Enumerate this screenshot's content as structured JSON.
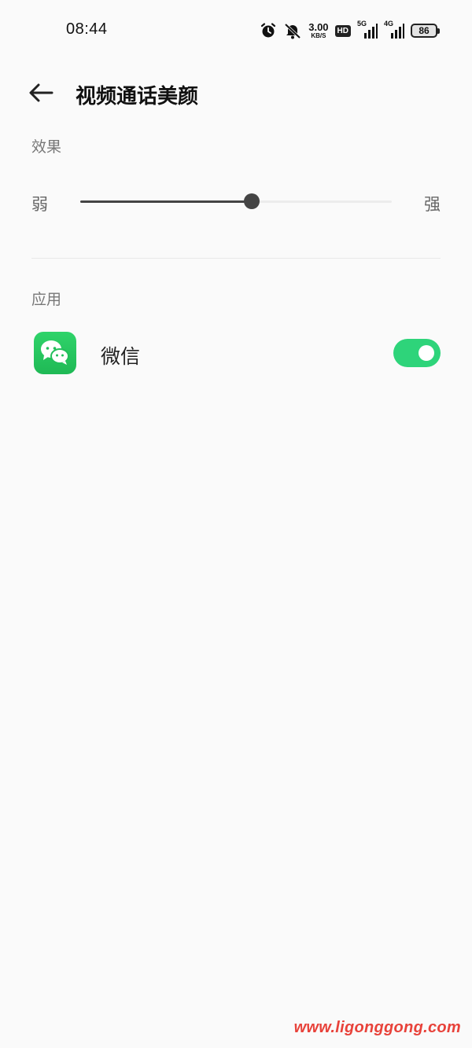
{
  "status_bar": {
    "time": "08:44",
    "net_speed_value": "3.00",
    "net_speed_unit": "KB/S",
    "hd_label": "HD",
    "signal_1_label": "5G",
    "signal_2_label": "4G",
    "battery_level": "86",
    "icons": [
      "alarm-icon",
      "mute-icon",
      "hd-voice-icon",
      "signal-5g-icon",
      "signal-4g-icon",
      "battery-icon"
    ]
  },
  "header": {
    "back_icon": "back-arrow-icon",
    "title": "视频通话美颜"
  },
  "effect_section": {
    "label": "效果",
    "slider": {
      "min_label": "弱",
      "max_label": "强",
      "value": 0.55
    }
  },
  "apps_section": {
    "label": "应用",
    "items": [
      {
        "name": "微信",
        "icon": "wechat-icon",
        "icon_color": "#2bc964",
        "enabled": true
      }
    ]
  },
  "colors": {
    "toggle_on": "#2ed47a",
    "slider_active": "#444444",
    "background": "#fafafa"
  },
  "watermark": "www.ligonggong.com"
}
